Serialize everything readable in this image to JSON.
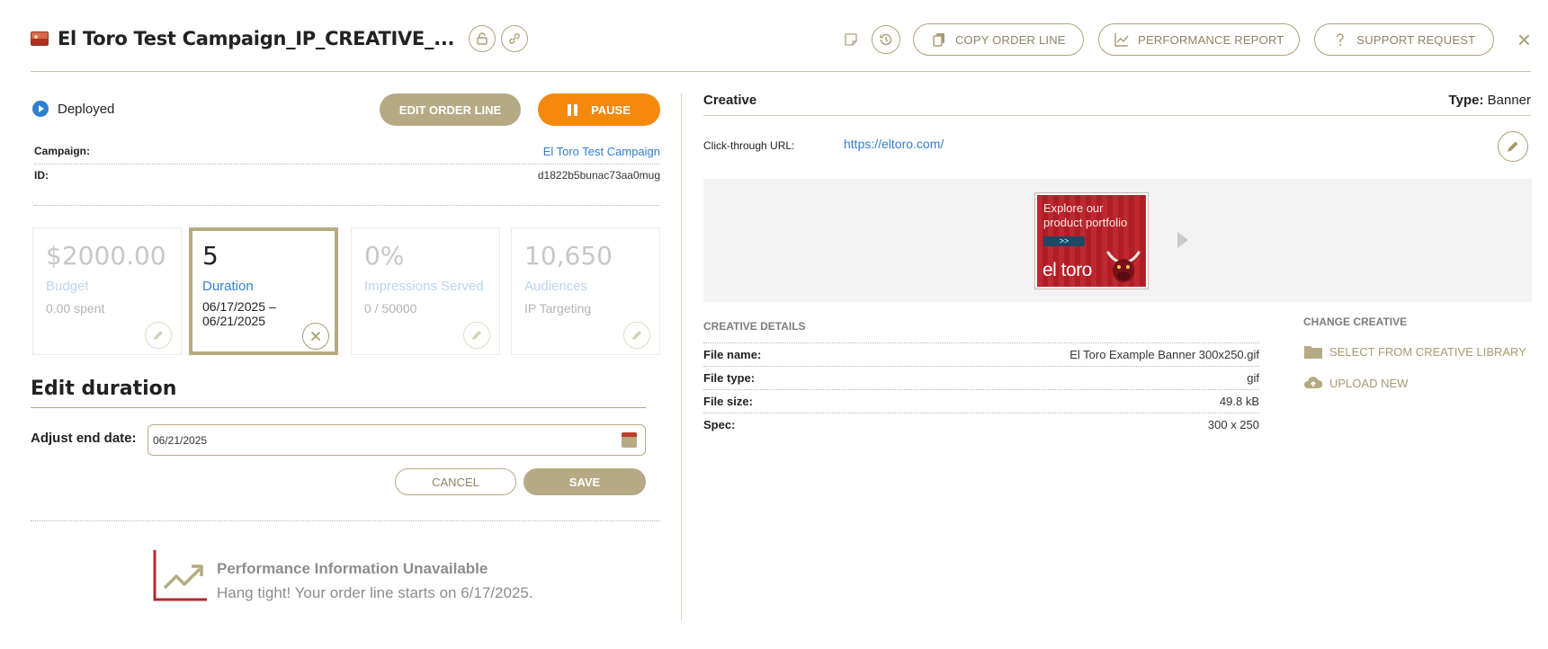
{
  "header": {
    "title": "El Toro Test Campaign_IP_CREATIVE_...",
    "copy_label": "COPY ORDER LINE",
    "report_label": "PERFORMANCE REPORT",
    "support_label": "SUPPORT REQUEST",
    "close_glyph": "×"
  },
  "status": {
    "label": "Deployed",
    "color": "#2f7fd0"
  },
  "actions": {
    "edit_label": "EDIT ORDER LINE",
    "pause_label": "PAUSE"
  },
  "details": {
    "campaign_label": "Campaign:",
    "campaign_value": "El Toro Test Campaign",
    "id_label": "ID:",
    "id_value": "d1822b5bunac73aa0mug"
  },
  "cards": [
    {
      "big": "$2000.00",
      "label": "Budget",
      "sub": "0.00 spent"
    },
    {
      "big": "5",
      "label": "Duration",
      "sub": "06/17/2025 – 06/21/2025"
    },
    {
      "big": "0%",
      "label": "Impressions Served",
      "sub": "0 / 50000"
    },
    {
      "big": "10,650",
      "label": "Audiences",
      "sub": "IP Targeting"
    }
  ],
  "edit_duration": {
    "title": "Edit duration",
    "adjust_label": "Adjust end date:",
    "end_date": "06/21/2025",
    "cancel_label": "CANCEL",
    "save_label": "SAVE"
  },
  "performance": {
    "title": "Performance Information Unavailable",
    "subtitle": "Hang tight! Your order line starts on 6/17/2025."
  },
  "creative": {
    "heading": "Creative",
    "type_label": "Type:",
    "type_value": "Banner",
    "click_through_label": "Click-through URL:",
    "click_through_url": "https://eltoro.com/",
    "banner": {
      "line1": "Explore our",
      "line2": "product portfolio",
      "cta": ">>",
      "brand": "el toro"
    },
    "details_heading": "CREATIVE DETAILS",
    "details": [
      {
        "k": "File name:",
        "v": "El Toro Example Banner 300x250.gif"
      },
      {
        "k": "File type:",
        "v": "gif"
      },
      {
        "k": "File size:",
        "v": "49.8 kB"
      },
      {
        "k": "Spec:",
        "v": "300 x 250"
      }
    ],
    "change_heading": "CHANGE CREATIVE",
    "select_library_label": "SELECT FROM CREATIVE LIBRARY",
    "upload_label": "UPLOAD NEW"
  },
  "colors": {
    "accent": "#b5aa84",
    "pause": "#f5890d",
    "link": "#2f7fd0"
  }
}
